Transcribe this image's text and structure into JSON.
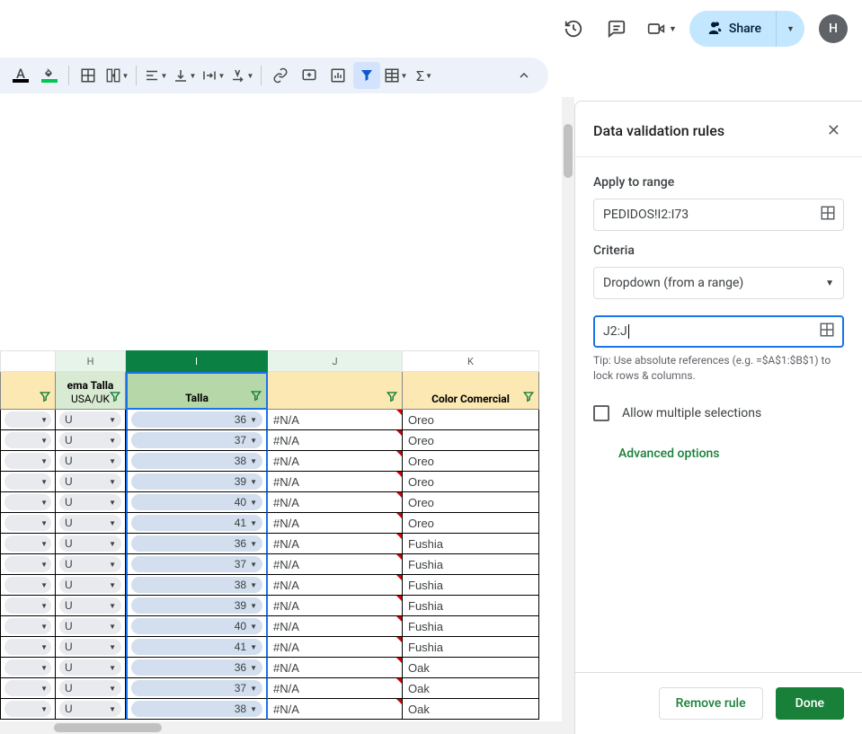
{
  "topbar": {
    "share_label": "Share",
    "avatar_initial": "H"
  },
  "toolbar": {
    "text_color_underline": "#000000",
    "fill_color_underline": "#00c853"
  },
  "grid": {
    "col_letters": {
      "g": "",
      "h": "H",
      "i": "I",
      "j": "J",
      "k": "K"
    },
    "headers": {
      "h_line1": "ema Talla",
      "h_line2": "USA/UK",
      "i": "Talla",
      "j": "",
      "k": "Color Comercial"
    },
    "rows": [
      {
        "h": "U",
        "i": "36",
        "j": "#N/A",
        "k": "Oreo"
      },
      {
        "h": "U",
        "i": "37",
        "j": "#N/A",
        "k": "Oreo"
      },
      {
        "h": "U",
        "i": "38",
        "j": "#N/A",
        "k": "Oreo"
      },
      {
        "h": "U",
        "i": "39",
        "j": "#N/A",
        "k": "Oreo"
      },
      {
        "h": "U",
        "i": "40",
        "j": "#N/A",
        "k": "Oreo"
      },
      {
        "h": "U",
        "i": "41",
        "j": "#N/A",
        "k": "Oreo"
      },
      {
        "h": "U",
        "i": "36",
        "j": "#N/A",
        "k": "Fushia"
      },
      {
        "h": "U",
        "i": "37",
        "j": "#N/A",
        "k": "Fushia"
      },
      {
        "h": "U",
        "i": "38",
        "j": "#N/A",
        "k": "Fushia"
      },
      {
        "h": "U",
        "i": "39",
        "j": "#N/A",
        "k": "Fushia"
      },
      {
        "h": "U",
        "i": "40",
        "j": "#N/A",
        "k": "Fushia"
      },
      {
        "h": "U",
        "i": "41",
        "j": "#N/A",
        "k": "Fushia"
      },
      {
        "h": "U",
        "i": "36",
        "j": "#N/A",
        "k": "Oak"
      },
      {
        "h": "U",
        "i": "37",
        "j": "#N/A",
        "k": "Oak"
      },
      {
        "h": "U",
        "i": "38",
        "j": "#N/A",
        "k": "Oak"
      }
    ]
  },
  "panel": {
    "title": "Data validation rules",
    "apply_label": "Apply to range",
    "apply_value": "PEDIDOS!I2:I73",
    "criteria_label": "Criteria",
    "criteria_value": "Dropdown (from a range)",
    "range_value": "J2:J",
    "tip": "Tip: Use absolute references (e.g. =$A$1:$B$1) to lock rows & columns.",
    "allow_multi": "Allow multiple selections",
    "advanced": "Advanced options",
    "remove": "Remove rule",
    "done": "Done"
  }
}
